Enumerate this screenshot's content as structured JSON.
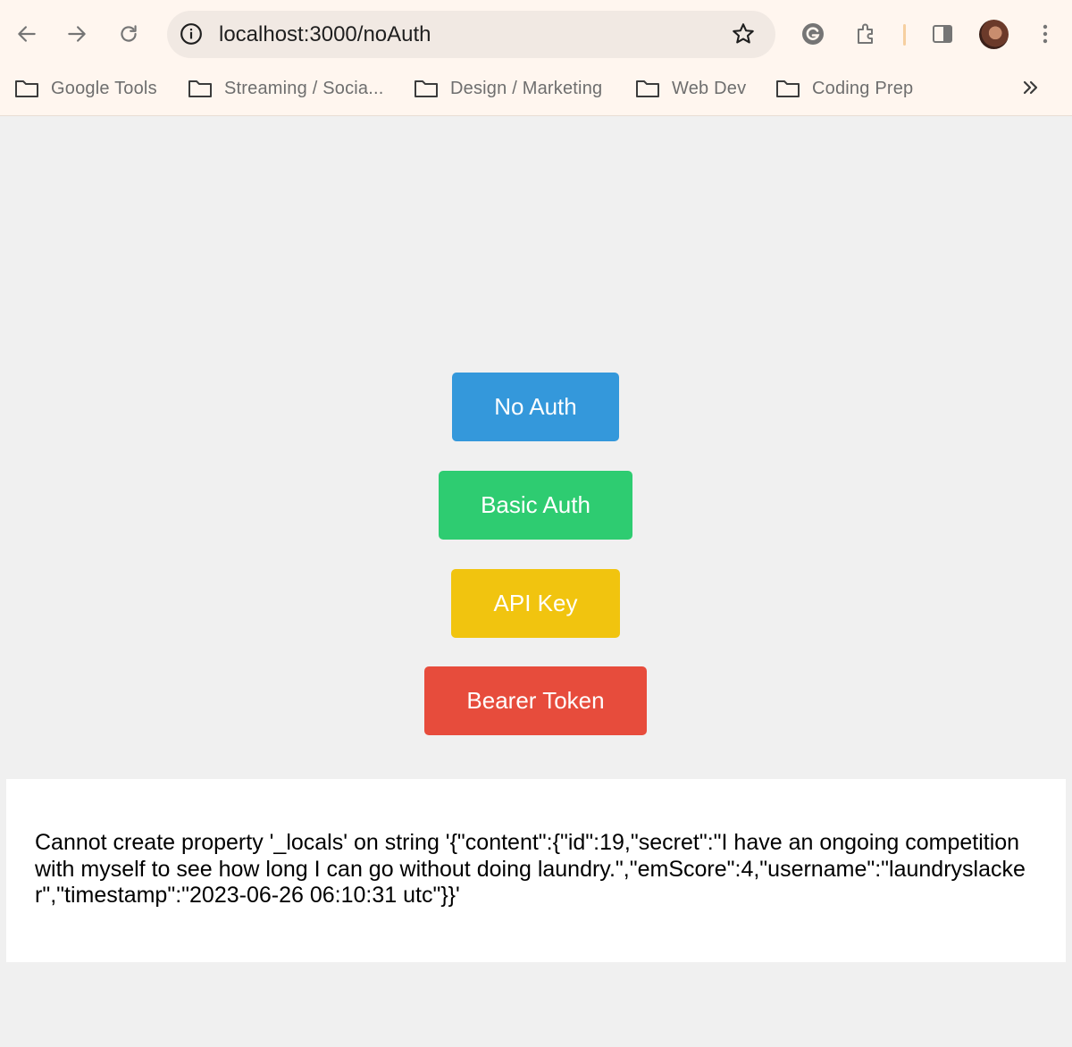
{
  "browser": {
    "url": "localhost:3000/noAuth",
    "bookmarks": [
      {
        "label": "Google Tools"
      },
      {
        "label": "Streaming / Socia..."
      },
      {
        "label": "Design / Marketing"
      },
      {
        "label": "Web Dev"
      },
      {
        "label": "Coding Prep"
      }
    ],
    "icons": [
      "back-icon",
      "forward-icon",
      "reload-icon",
      "site-info-icon",
      "star-icon",
      "grammarly-icon",
      "extensions-icon",
      "side-panel-icon",
      "avatar",
      "more-menu-icon",
      "bookmarks-overflow-icon"
    ]
  },
  "page": {
    "buttons": [
      {
        "label": "No Auth",
        "color": "#3498db"
      },
      {
        "label": "Basic Auth",
        "color": "#2ecc71"
      },
      {
        "label": "API Key",
        "color": "#f1c40f"
      },
      {
        "label": "Bearer Token",
        "color": "#e74c3c"
      }
    ],
    "result_text": "Cannot create property '_locals' on string '{\"content\":{\"id\":19,\"secret\":\"I have an ongoing competition with myself to see how long I can go without doing laundry.\",\"emScore\":4,\"username\":\"laundryslacker\",\"timestamp\":\"2023-06-26 06:10:31 utc\"}}'"
  }
}
